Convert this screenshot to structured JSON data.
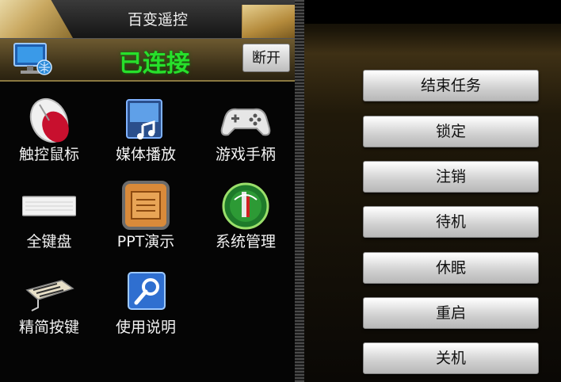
{
  "app": {
    "title": "百变遥控",
    "status": "已连接",
    "disconnect_label": "断开"
  },
  "tiles": [
    {
      "label": "触控鼠标",
      "icon": "mouse-icon"
    },
    {
      "label": "媒体播放",
      "icon": "media-player-icon"
    },
    {
      "label": "游戏手柄",
      "icon": "gamepad-icon"
    },
    {
      "label": "全键盘",
      "icon": "keyboard-icon"
    },
    {
      "label": "PPT演示",
      "icon": "presentation-icon"
    },
    {
      "label": "系统管理",
      "icon": "system-gauge-icon"
    },
    {
      "label": "精简按键",
      "icon": "simple-keys-icon"
    },
    {
      "label": "使用说明",
      "icon": "help-search-icon"
    }
  ],
  "commands": [
    {
      "label": "结束任务"
    },
    {
      "label": "锁定"
    },
    {
      "label": "注销"
    },
    {
      "label": "待机"
    },
    {
      "label": "休眠"
    },
    {
      "label": "重启"
    },
    {
      "label": "关机"
    }
  ],
  "colors": {
    "status_green": "#27e02b",
    "gold_accent": "#c9a860"
  }
}
